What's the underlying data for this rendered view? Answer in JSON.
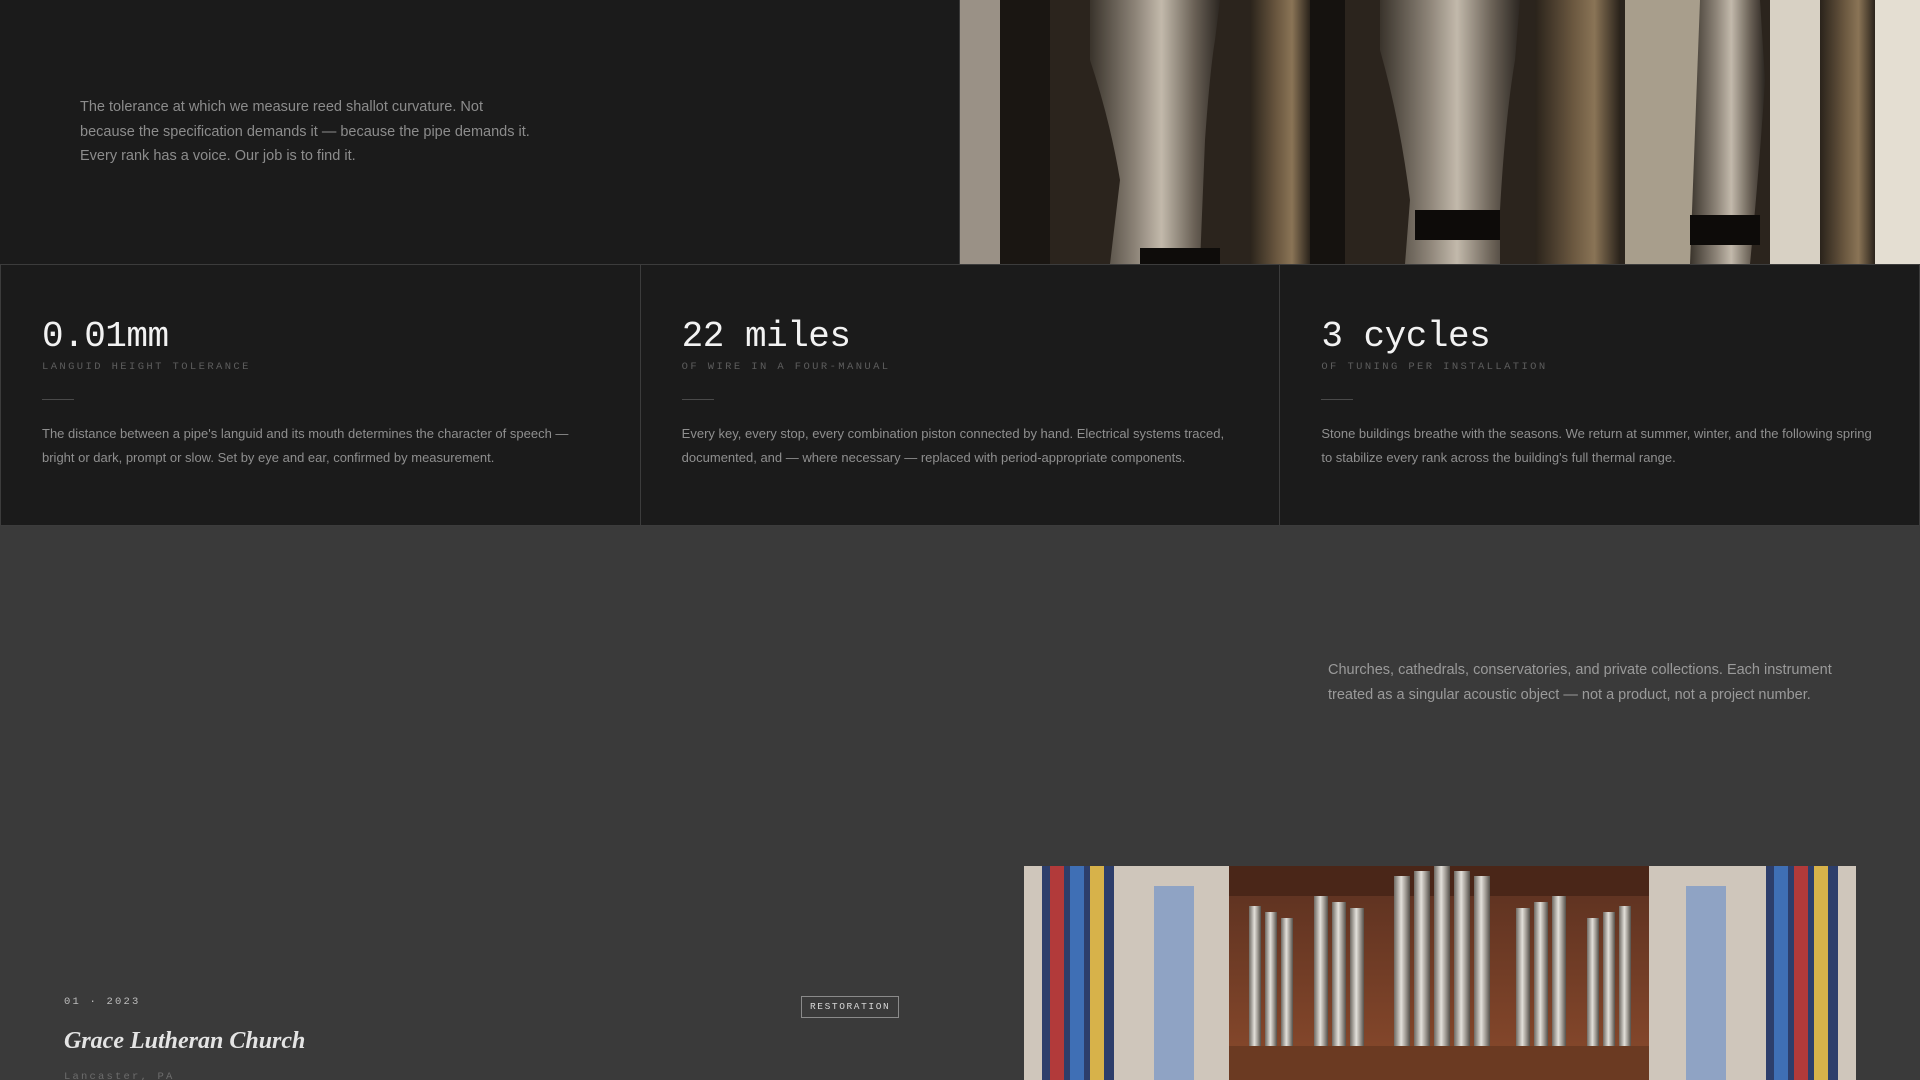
{
  "hero": {
    "intro": "The tolerance at which we measure reed shallot curvature. Not because the specification demands it — because the pipe demands it. Every rank has a voice. Our job is to find it.",
    "photo_icon": "organ-reed-pipes-photo"
  },
  "stats": [
    {
      "value": "0.01mm",
      "label": "Languid height tolerance",
      "description": "The distance between a pipe's languid and its mouth determines the character of speech — bright or dark, prompt or slow. Set by eye and ear, confirmed by measurement."
    },
    {
      "value": "22 miles",
      "label": "Of wire in a four-manual",
      "description": "Every key, every stop, every combination piston connected by hand. Electrical systems traced, documented, and — where necessary — replaced with period-appropriate components."
    },
    {
      "value": "3 cycles",
      "label": "Of tuning per installation",
      "description": "Stone buildings breathe with the seasons. We return at summer, winter, and the following spring to stabilize every rank across the building's full thermal range."
    }
  ],
  "clients": {
    "text": "Churches, cathedrals, conservatories, and private collections. Each instrument treated as a singular acoustic object — not a product, not a project number."
  },
  "project": {
    "meta": "01 · 2023",
    "tag": "Restoration",
    "title": "Grace Lutheran Church",
    "location": "Lancaster, PA",
    "photo_icon": "pipe-organ-church-photo"
  },
  "colors": {
    "dark_panel": "#1b1b1b",
    "page_background": "#3a3a3a",
    "stat_value": "#f2f2f2"
  }
}
